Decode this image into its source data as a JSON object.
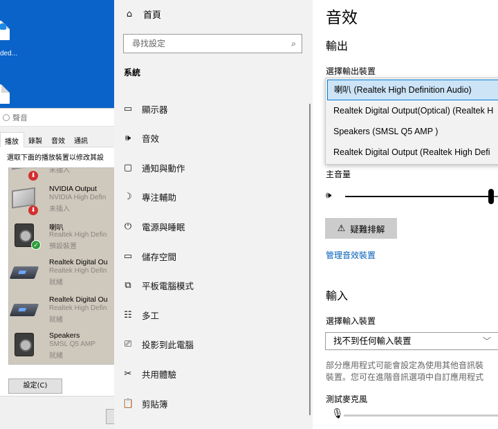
{
  "desktop": {
    "icon_label": "ded..."
  },
  "sound_dialog": {
    "title": "聲音",
    "tabs": [
      "播放",
      "錄製",
      "音效",
      "通訊"
    ],
    "instruction": "選取下面的播放裝置以修改其設",
    "devices": [
      {
        "name": "",
        "sub": "",
        "status": "未插入"
      },
      {
        "name": "NVIDIA Output",
        "sub": "NVIDIA High Defin",
        "status": "未插入"
      },
      {
        "name": "喇叭",
        "sub": "Realtek High Defin",
        "status": "預設裝置"
      },
      {
        "name": "Realtek Digital Ou",
        "sub": "Realtek High Defin",
        "status": "就緒"
      },
      {
        "name": "Realtek Digital Ou",
        "sub": "Realtek High Defin",
        "status": "就緒"
      },
      {
        "name": "Speakers",
        "sub": "SMSL Q5 AMP",
        "status": "就緒"
      }
    ],
    "configure_button": "設定(C)"
  },
  "nav": {
    "home": "首頁",
    "search_placeholder": "尋找設定",
    "section": "系統",
    "items": [
      {
        "label": "顯示器",
        "icon": "monitor-icon",
        "glyph": "▭"
      },
      {
        "label": "音效",
        "icon": "speaker-icon",
        "glyph": "🕪"
      },
      {
        "label": "通知與動作",
        "icon": "notification-icon",
        "glyph": "▢"
      },
      {
        "label": "專注輔助",
        "icon": "moon-icon",
        "glyph": "☽"
      },
      {
        "label": "電源與睡眠",
        "icon": "power-icon",
        "glyph": "⏻"
      },
      {
        "label": "儲存空間",
        "icon": "storage-icon",
        "glyph": "▭"
      },
      {
        "label": "平板電腦模式",
        "icon": "tablet-icon",
        "glyph": "⧉"
      },
      {
        "label": "多工",
        "icon": "multitask-icon",
        "glyph": "☷"
      },
      {
        "label": "投影到此電腦",
        "icon": "project-icon",
        "glyph": "⎚"
      },
      {
        "label": "共用體驗",
        "icon": "share-icon",
        "glyph": "✂"
      },
      {
        "label": "剪貼簿",
        "icon": "clipboard-icon",
        "glyph": "📋"
      }
    ]
  },
  "main": {
    "title": "音效",
    "output_heading": "輸出",
    "output_device_label": "選擇輸出裝置",
    "output_options": [
      "喇叭 (Realtek High Definition Audio)",
      "Realtek Digital Output(Optical) (Realtek H",
      "Speakers (SMSL Q5 AMP )",
      "Realtek Digital Output (Realtek High Defi"
    ],
    "master_volume_label": "主音量",
    "master_volume": 0.95,
    "troubleshoot_button": "疑難排解",
    "manage_devices_link": "管理音效裝置",
    "input_heading": "輸入",
    "input_device_label": "選擇輸入裝置",
    "input_device_value": "找不到任何輸入裝置",
    "note_line1": "部分應用程式可能會設定為使用其他音訊裝",
    "note_line2": "裝置。您可在進階音訊選項中自訂應用程式",
    "mic_test_label": "測試麥克風"
  }
}
